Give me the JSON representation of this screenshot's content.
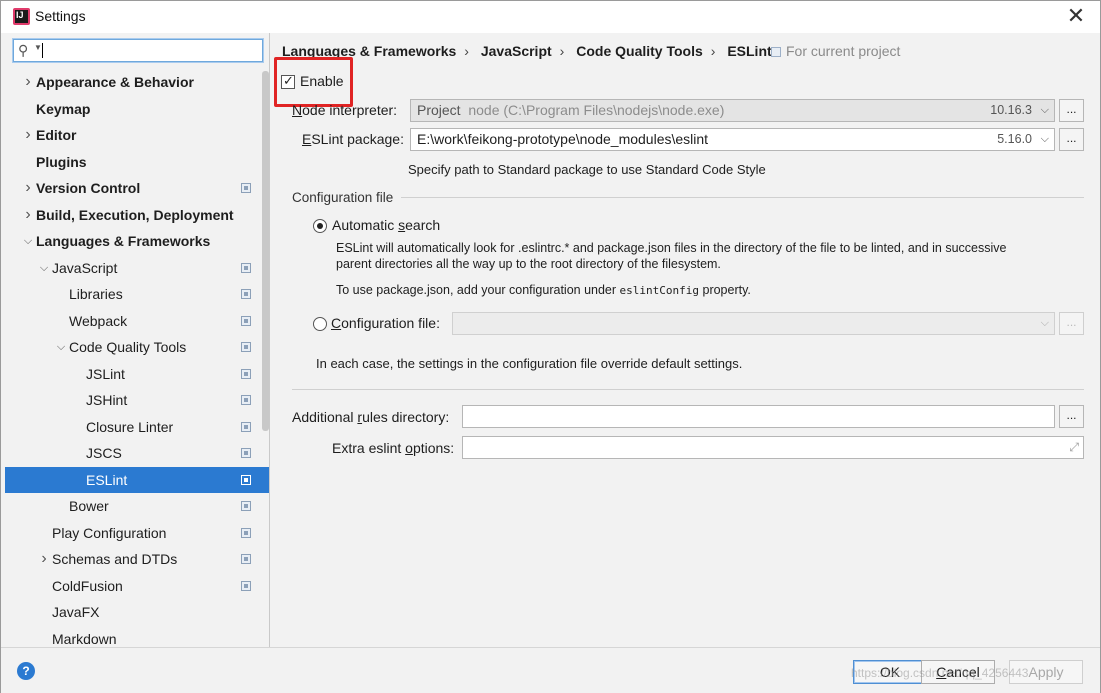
{
  "window": {
    "title": "Settings"
  },
  "search": {
    "value": "",
    "placeholder": ""
  },
  "tree": [
    {
      "label": "Appearance & Behavior",
      "bold": true,
      "arrow": "right",
      "level": 0,
      "proj": false
    },
    {
      "label": "Keymap",
      "bold": true,
      "arrow": "",
      "level": 0,
      "proj": false
    },
    {
      "label": "Editor",
      "bold": true,
      "arrow": "right",
      "level": 0,
      "proj": false
    },
    {
      "label": "Plugins",
      "bold": true,
      "arrow": "",
      "level": 0,
      "proj": false
    },
    {
      "label": "Version Control",
      "bold": true,
      "arrow": "right",
      "level": 0,
      "proj": true
    },
    {
      "label": "Build, Execution, Deployment",
      "bold": true,
      "arrow": "right",
      "level": 0,
      "proj": false
    },
    {
      "label": "Languages & Frameworks",
      "bold": true,
      "arrow": "down",
      "level": 0,
      "proj": false
    },
    {
      "label": "JavaScript",
      "bold": false,
      "arrow": "down",
      "level": 1,
      "proj": true
    },
    {
      "label": "Libraries",
      "bold": false,
      "arrow": "",
      "level": 2,
      "proj": true
    },
    {
      "label": "Webpack",
      "bold": false,
      "arrow": "",
      "level": 2,
      "proj": true
    },
    {
      "label": "Code Quality Tools",
      "bold": false,
      "arrow": "down",
      "level": 2,
      "proj": true
    },
    {
      "label": "JSLint",
      "bold": false,
      "arrow": "",
      "level": 3,
      "proj": true
    },
    {
      "label": "JSHint",
      "bold": false,
      "arrow": "",
      "level": 3,
      "proj": true
    },
    {
      "label": "Closure Linter",
      "bold": false,
      "arrow": "",
      "level": 3,
      "proj": true
    },
    {
      "label": "JSCS",
      "bold": false,
      "arrow": "",
      "level": 3,
      "proj": true
    },
    {
      "label": "ESLint",
      "bold": false,
      "arrow": "",
      "level": 3,
      "proj": true,
      "selected": true
    },
    {
      "label": "Bower",
      "bold": false,
      "arrow": "",
      "level": 2,
      "proj": true
    },
    {
      "label": "Play Configuration",
      "bold": false,
      "arrow": "",
      "level": 1,
      "proj": true
    },
    {
      "label": "Schemas and DTDs",
      "bold": false,
      "arrow": "right",
      "level": 1,
      "proj": true
    },
    {
      "label": "ColdFusion",
      "bold": false,
      "arrow": "",
      "level": 1,
      "proj": true
    },
    {
      "label": "JavaFX",
      "bold": false,
      "arrow": "",
      "level": 1,
      "proj": false
    },
    {
      "label": "Markdown",
      "bold": false,
      "arrow": "",
      "level": 1,
      "proj": false
    }
  ],
  "breadcrumb": [
    "Languages & Frameworks",
    "JavaScript",
    "Code Quality Tools",
    "ESLint"
  ],
  "breadcrumb_sep": "›",
  "for_project": "For current project",
  "enable": {
    "label": "Enable",
    "checked": true
  },
  "node_interpreter": {
    "label": "Node interpreter:",
    "kind": "Project",
    "path": "node (C:\\Program Files\\nodejs\\node.exe)",
    "version": "10.16.3"
  },
  "eslint_package": {
    "label": "ESLint package:",
    "value": "E:\\work\\feikong-prototype\\node_modules\\eslint",
    "version": "5.16.0"
  },
  "standard_hint": "Specify path to Standard package to use Standard Code Style",
  "config_section": {
    "title": "Configuration file",
    "auto_label": "Automatic search",
    "auto_desc_1": "ESLint will automatically look for .eslintrc.* and package.json files in the directory of the file to be linted, and in successive",
    "auto_desc_2": "parent directories all the way up to the root directory of the filesystem.",
    "auto_desc_3_pre": "To use package.json, add your configuration under ",
    "auto_desc_3_code": "eslintConfig",
    "auto_desc_3_post": " property.",
    "file_label": "Configuration file:",
    "file_value": "",
    "note": "In each case, the settings in the configuration file override default settings."
  },
  "additional_rules": {
    "label": "Additional rules directory:",
    "value": ""
  },
  "extra_options": {
    "label": "Extra eslint options:",
    "value": ""
  },
  "dots": "...",
  "buttons": {
    "help": "?",
    "ok": "OK",
    "cancel": "Cancel",
    "apply": "Apply"
  },
  "watermark": "https://blog.csdn.net/qq_4256443"
}
